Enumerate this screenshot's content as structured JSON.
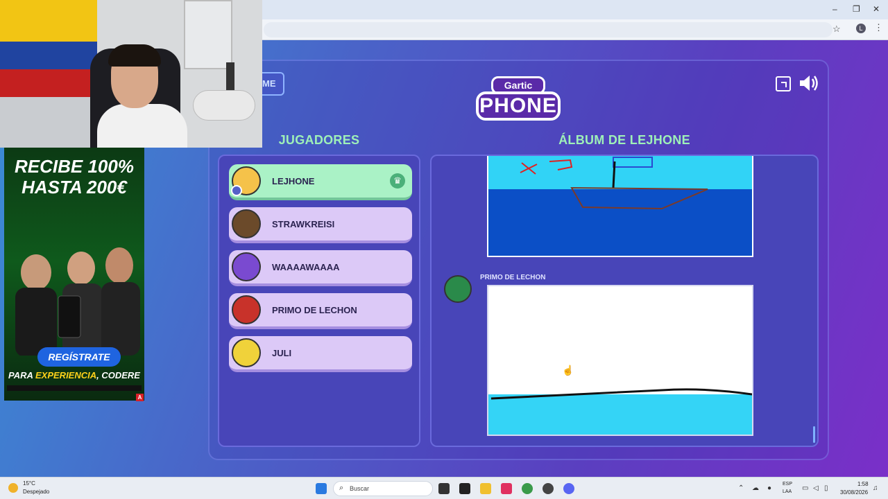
{
  "browser": {
    "window_controls": [
      "–",
      "❐",
      "✕"
    ],
    "profile_initial": "L"
  },
  "game": {
    "home_button_label": "ME",
    "logo_top": "Gartic",
    "logo_main": "PHONE",
    "players_title": "JUGADORES",
    "album_title": "ÁLBUM DE LEJHONE",
    "players": [
      {
        "name": "LEJHONE",
        "avatar_color": "#f5c24a",
        "active": true,
        "host": true
      },
      {
        "name": "STRAWKREISI",
        "avatar_color": "#6b4a2a",
        "active": false
      },
      {
        "name": "WAAAAWAAAA",
        "avatar_color": "#7a4ad0",
        "active": false
      },
      {
        "name": "PRIMO DE LECHON",
        "avatar_color": "#c8322a",
        "active": false
      },
      {
        "name": "JULI",
        "avatar_color": "#f0d23a",
        "active": false
      }
    ],
    "album": {
      "entry_author": "PRIMO DE LECHON",
      "drawing1_doodle": "XD"
    }
  },
  "ad": {
    "headline_line1": "RECIBE 100%",
    "headline_line2": "HASTA 200€",
    "cta": "REGÍSTRATE",
    "tagline_prefix": "PARA ",
    "tagline_highlight": "EXPERIENCIA",
    "tagline_suffix": ", CODERE",
    "badge": "A"
  },
  "taskbar": {
    "temperature": "15°C",
    "weather": "Despejado",
    "search_placeholder": "Buscar",
    "lang_top": "ESP",
    "lang_bottom": "LAA",
    "time": "1:58",
    "date": "30/08/2026"
  }
}
